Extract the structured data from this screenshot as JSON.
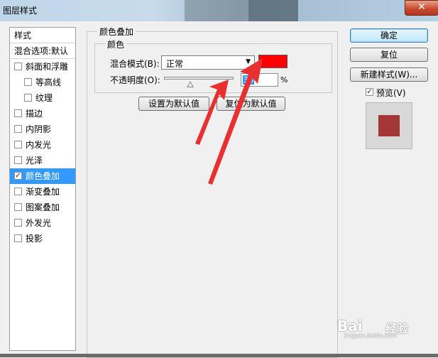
{
  "window": {
    "title": "图层样式",
    "close_icon": "close-icon"
  },
  "style_list": {
    "header": "样式",
    "blend_options": "混合选项:默认",
    "items": [
      {
        "label": "斜面和浮雕",
        "checked": false,
        "sub": false,
        "selected": false
      },
      {
        "label": "等高线",
        "checked": false,
        "sub": true,
        "selected": false
      },
      {
        "label": "纹理",
        "checked": false,
        "sub": true,
        "selected": false
      },
      {
        "label": "描边",
        "checked": false,
        "sub": false,
        "selected": false
      },
      {
        "label": "内阴影",
        "checked": false,
        "sub": false,
        "selected": false
      },
      {
        "label": "内发光",
        "checked": false,
        "sub": false,
        "selected": false
      },
      {
        "label": "光泽",
        "checked": false,
        "sub": false,
        "selected": false
      },
      {
        "label": "颜色叠加",
        "checked": true,
        "sub": false,
        "selected": true
      },
      {
        "label": "渐变叠加",
        "checked": false,
        "sub": false,
        "selected": false
      },
      {
        "label": "图案叠加",
        "checked": false,
        "sub": false,
        "selected": false
      },
      {
        "label": "外发光",
        "checked": false,
        "sub": false,
        "selected": false
      },
      {
        "label": "投影",
        "checked": false,
        "sub": false,
        "selected": false
      }
    ]
  },
  "overlay": {
    "group_title": "颜色叠加",
    "sub_title": "颜色",
    "blend_mode_label": "混合模式(B):",
    "blend_mode_value": "正常",
    "overlay_color": "#ff0000",
    "opacity_label": "不透明度(O):",
    "opacity_value": "38",
    "opacity_fraction": 0.38,
    "percent_sign": "%",
    "set_default": "设置为默认值",
    "reset_default": "复位为默认值"
  },
  "actions": {
    "ok": "确定",
    "reset": "复位",
    "new_style": "新建样式(W)...",
    "preview_label": "预览(V)",
    "preview_checked": true,
    "preview_color": "#a33637"
  },
  "watermark": {
    "brand": "Bai",
    "brand2": "经验",
    "url": "jingyan.baidu.com"
  }
}
